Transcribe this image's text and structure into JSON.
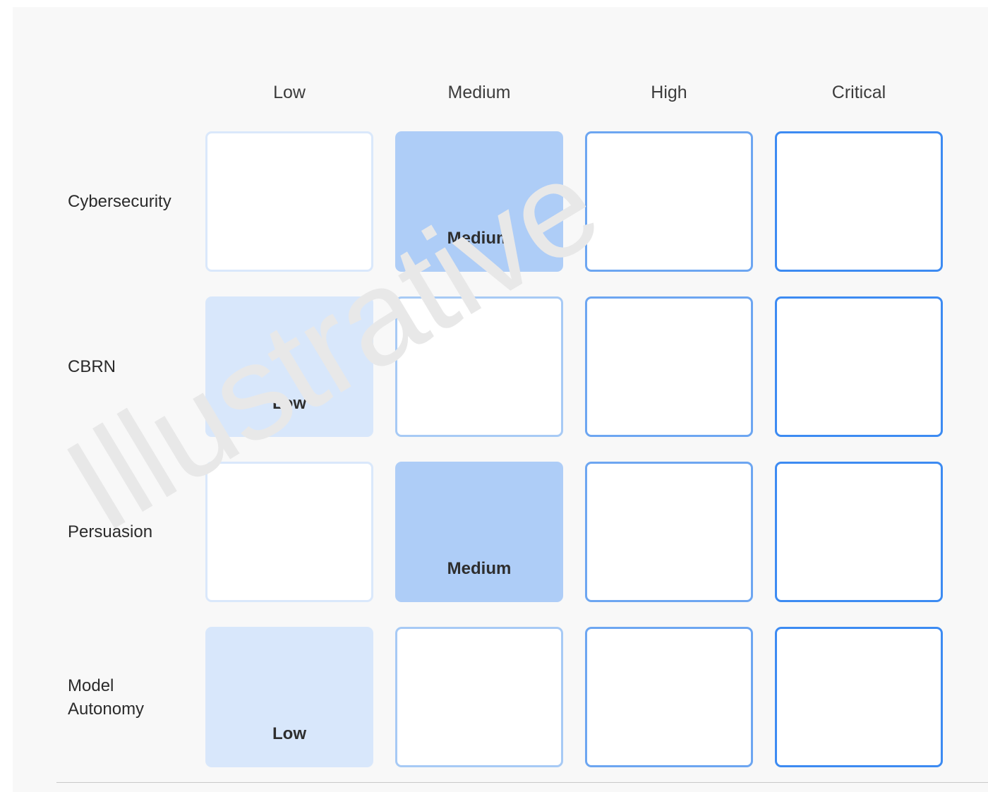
{
  "watermark": {
    "text": "Illustrative"
  },
  "matrix": {
    "column_headers": [
      "Low",
      "Medium",
      "High",
      "Critical"
    ],
    "row_labels": [
      "Cybersecurity",
      "CBRN",
      "Persuasion",
      "Model Autonomy"
    ],
    "rows": [
      {
        "label": "Cybersecurity",
        "cells": [
          {
            "level": "low",
            "label": "",
            "active": false
          },
          {
            "level": "medium",
            "label": "Medium",
            "active": true
          },
          {
            "level": "high",
            "label": "",
            "active": false
          },
          {
            "level": "critical",
            "label": "",
            "active": false
          }
        ]
      },
      {
        "label": "CBRN",
        "cells": [
          {
            "level": "low",
            "label": "Low",
            "active": true
          },
          {
            "level": "medium",
            "label": "",
            "active": false
          },
          {
            "level": "high",
            "label": "",
            "active": false
          },
          {
            "level": "critical",
            "label": "",
            "active": false
          }
        ]
      },
      {
        "label": "Persuasion",
        "cells": [
          {
            "level": "low",
            "label": "",
            "active": false
          },
          {
            "level": "medium",
            "label": "Medium",
            "active": true
          },
          {
            "level": "high",
            "label": "",
            "active": false
          },
          {
            "level": "critical",
            "label": "",
            "active": false
          }
        ]
      },
      {
        "label": "Model Autonomy",
        "cells": [
          {
            "level": "low",
            "label": "Low",
            "active": true
          },
          {
            "level": "medium",
            "label": "",
            "active": false
          },
          {
            "level": "high",
            "label": "",
            "active": false
          },
          {
            "level": "critical",
            "label": "",
            "active": false
          }
        ]
      }
    ]
  },
  "colors": {
    "background": "#f8f8f8",
    "cell_fill_low": "#d8e7fb",
    "cell_fill_medium": "#aecdf7",
    "border_low": "#dae8fb",
    "border_medium": "#a7caf5",
    "border_high": "#6da6f1",
    "border_critical": "#3d8bf2",
    "watermark": "#e8e8e8",
    "divider": "#c9c9c9",
    "text": "#2b2b2b"
  },
  "chart_data": {
    "type": "heatmap",
    "title": "",
    "xlabel": "",
    "ylabel": "",
    "categories": [
      "Low",
      "Medium",
      "High",
      "Critical"
    ],
    "rows": [
      "Cybersecurity",
      "CBRN",
      "Persuasion",
      "Model Autonomy"
    ],
    "values": [
      [
        "",
        "Medium",
        "",
        ""
      ],
      [
        "Low",
        "",
        "",
        ""
      ],
      [
        "",
        "Medium",
        "",
        ""
      ],
      [
        "Low",
        "",
        "",
        ""
      ]
    ],
    "legend": [],
    "grid": false,
    "annotations": [
      "Illustrative"
    ]
  }
}
